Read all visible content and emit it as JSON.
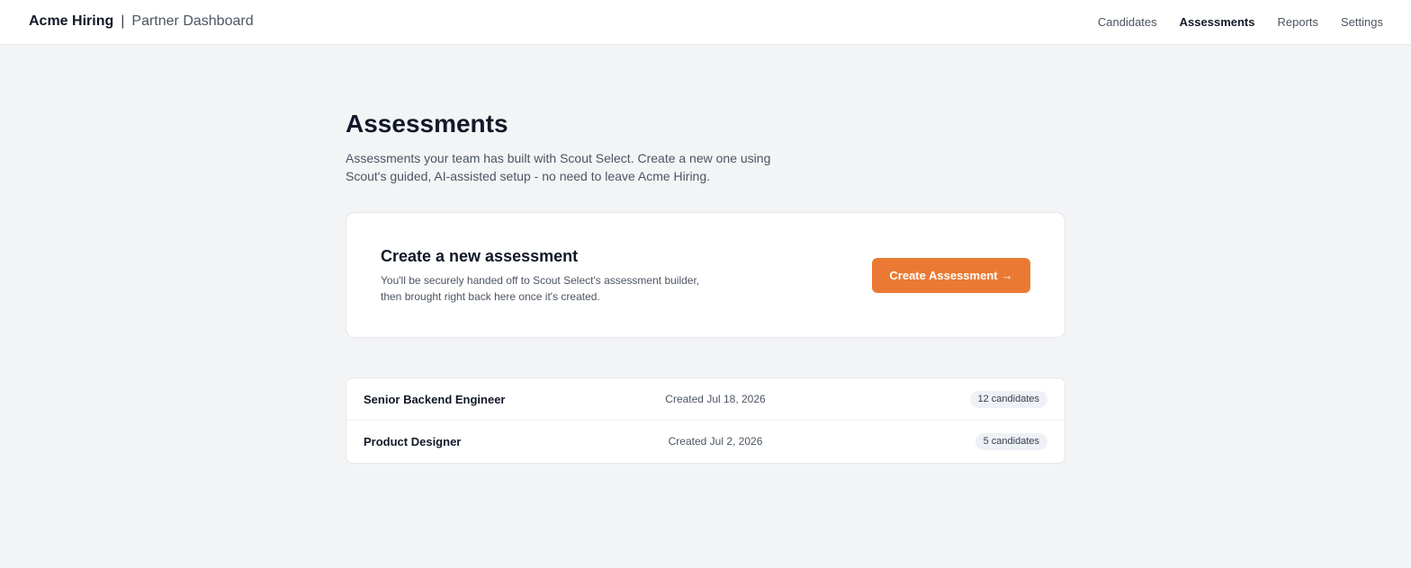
{
  "header": {
    "brand_name": "Acme Hiring",
    "separator": "|",
    "brand_subtitle": "Partner Dashboard",
    "nav": [
      {
        "label": "Candidates",
        "active": false
      },
      {
        "label": "Assessments",
        "active": true
      },
      {
        "label": "Reports",
        "active": false
      },
      {
        "label": "Settings",
        "active": false
      }
    ]
  },
  "page": {
    "title": "Assessments",
    "description": "Assessments your team has built with Scout Select. Create a new one using Scout's guided, AI-assisted setup - no need to leave Acme Hiring."
  },
  "create_card": {
    "title": "Create a new assessment",
    "description": "You'll be securely handed off to Scout Select's assessment builder, then brought right back here once it's created.",
    "button_label": "Create Assessment",
    "button_arrow": "→",
    "accent_color": "#ea7a33"
  },
  "assessments": [
    {
      "name": "Senior Backend Engineer",
      "created": "Created Jul 18, 2026",
      "candidates": "12 candidates"
    },
    {
      "name": "Product Designer",
      "created": "Created Jul 2, 2026",
      "candidates": "5 candidates"
    }
  ]
}
